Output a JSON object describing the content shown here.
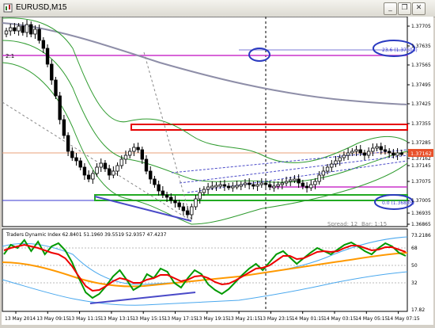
{
  "window": {
    "title": "EURUSD,M15",
    "minimize_label": "_",
    "restore_label": "❐",
    "close_label": "✕"
  },
  "main_chart": {
    "price_ticks": [
      "1.37705",
      "1.37635",
      "1.37565",
      "1.37495",
      "1.37425",
      "1.37355",
      "1.37285",
      "1.37215",
      "1.37162",
      "1.37145",
      "1.37075",
      "1.37005",
      "1.36935",
      "1.36865"
    ],
    "current_price": "1.37162",
    "left_edge_label": "2:1",
    "fib_top_label": "23.6 (1.37604)",
    "fib_bottom_label": "0.0 (1.36885)",
    "spread_label": "Spread:  12",
    "bar_label": "Bar:  1:15"
  },
  "indicator": {
    "label": "Traders Dynamic Index 62.8401 51.1960 39.5519 52.9357 47.4237",
    "level_ticks": [
      "73.2186",
      "68",
      "50",
      "32",
      "17.82"
    ]
  },
  "time_axis": {
    "labels": [
      "13 May 2014",
      "13 May 09:15",
      "13 May 11:15",
      "13 May 13:15",
      "13 May 15:15",
      "13 May 17:15",
      "13 May 19:15",
      "13 May 21:15",
      "13 May 23:15",
      "14 May 01:15",
      "14 May 03:15",
      "14 May 05:15",
      "14 May 07:15"
    ]
  },
  "colors": {
    "candle": "#000000",
    "bollinger": "#2e9b2e",
    "slow_ma": "#8e8ea8",
    "magenta": "#cc33cc",
    "red_box": "#e60000",
    "green_box": "#22aa22",
    "blue_trend": "#4a4ac8",
    "tdi_green": "#009900",
    "tdi_red": "#ee0000",
    "tdi_orange": "#ff9900",
    "tdi_blue": "#4aa8ee"
  }
}
